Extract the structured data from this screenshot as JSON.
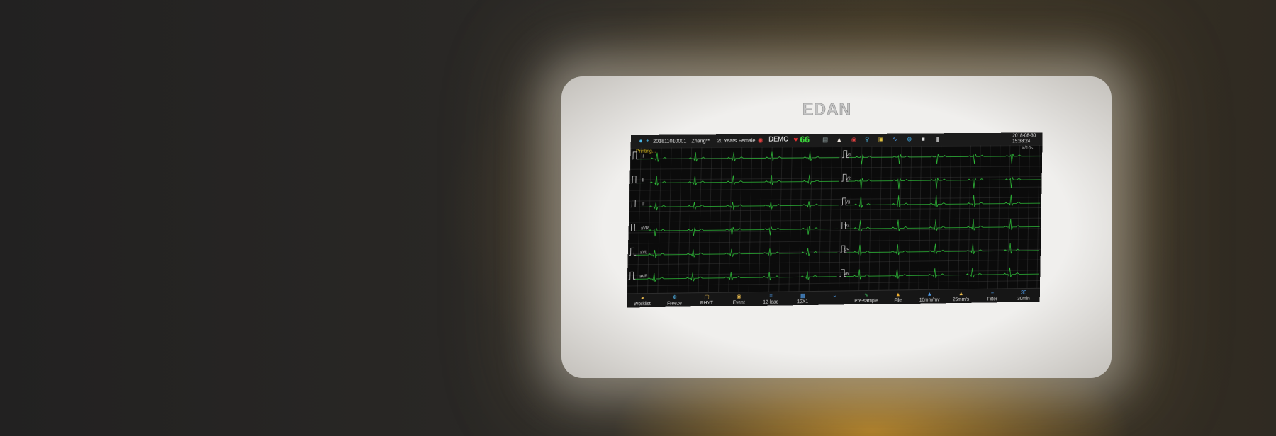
{
  "brand": "EDAN",
  "top_bar": {
    "patient_id": "201811010001",
    "patient_name": "Zhang**",
    "age": "20 Years",
    "gender": "Female",
    "mode": "DEMO",
    "heart_rate": "66",
    "date": "2018-08-30",
    "time": "15:33:24",
    "icons": [
      "patient-icon",
      "add-icon",
      "pills-icon",
      "heart-icon",
      "network-icon",
      "shirt-icon",
      "pills-icon",
      "search-icon",
      "image-icon",
      "wave-icon",
      "wifi-icon",
      "lock-icon",
      "battery-icon"
    ]
  },
  "screen": {
    "status": "Printing...",
    "scale": "X/10s",
    "leads_left": [
      "I",
      "II",
      "III",
      "aVR",
      "aVL",
      "aVF"
    ],
    "leads_right": [
      "V1",
      "V2",
      "V3",
      "V4",
      "V5",
      "V6"
    ],
    "trace_color": "#2fbf3a"
  },
  "bottom_bar": [
    {
      "label": "Worklist",
      "icon": "worklist-icon"
    },
    {
      "label": "Freeze",
      "icon": "snowflake-icon"
    },
    {
      "label": "RHYT",
      "icon": "rhythm-icon"
    },
    {
      "label": "Event",
      "icon": "pin-icon"
    },
    {
      "label": "12-lead",
      "icon": "lead-icon"
    },
    {
      "label": "12X1",
      "icon": "layout-icon"
    },
    {
      "label": "",
      "icon": "chevron-down-icon"
    },
    {
      "label": "Pre-sample",
      "icon": "presample-icon"
    },
    {
      "label": "File",
      "icon": "folder-icon"
    },
    {
      "label": "10mm/mv",
      "icon": "gain-icon"
    },
    {
      "label": "25mm/s",
      "icon": "speed-icon"
    },
    {
      "label": "Filter",
      "icon": "filter-icon"
    },
    {
      "label": "30min",
      "icon": "timer-icon"
    }
  ]
}
